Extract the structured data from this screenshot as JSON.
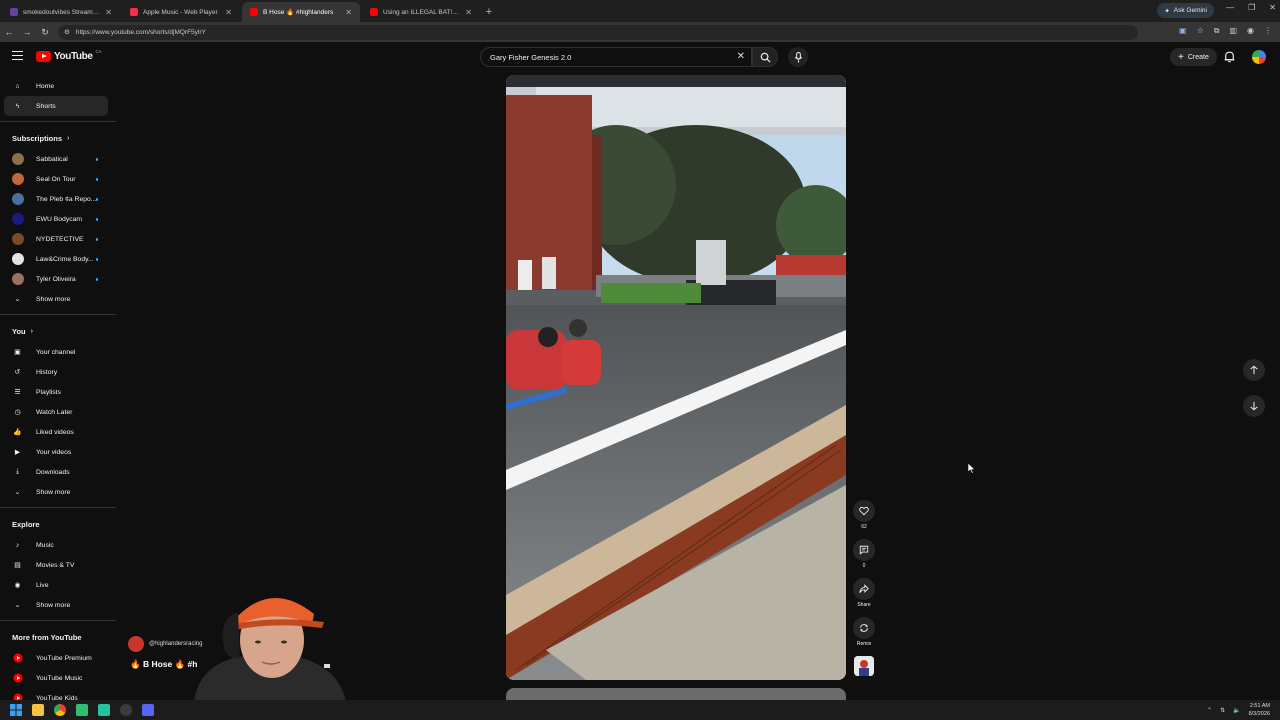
{
  "browser": {
    "tabs": [
      {
        "title": "smokedoutvibes Stream - Watc",
        "favicon_color": "#6441a5",
        "active": false
      },
      {
        "title": "Apple Music - Web Player",
        "favicon_color": "#fa2d48",
        "active": false
      },
      {
        "title": "B Hose 🔥 #highlanders",
        "favicon_color": "#ff0000",
        "active": true
      },
      {
        "title": "Using an ILLEGAL BAT! 😮 🤯",
        "favicon_color": "#ff0000",
        "active": false
      }
    ],
    "ask_gemini": "Ask Gemini",
    "url": "https://www.youtube.com/shorts/djMQrF5ylrY"
  },
  "header": {
    "logo_text": "YouTube",
    "logo_country": "CA",
    "search_value": "Gary Fisher Genesis 2.0",
    "create_label": "Create"
  },
  "sidebar": {
    "main": [
      {
        "label": "Home",
        "icon": "home-icon",
        "active": false
      },
      {
        "label": "Shorts",
        "icon": "shorts-icon",
        "active": true
      }
    ],
    "subscriptions_title": "Subscriptions",
    "subscriptions": [
      {
        "label": "Sabbatical",
        "color": "#8b6f4e"
      },
      {
        "label": "Seal On Tour",
        "color": "#c06a3c"
      },
      {
        "label": "The Pleb ¢a Repo...",
        "color": "#4a6fa5"
      },
      {
        "label": "EWU Bodycam",
        "color": "#1a1a80"
      },
      {
        "label": "NYDETECTIVE",
        "color": "#7a4a2a"
      },
      {
        "label": "Law&Crime Body...",
        "color": "#e5e5e5"
      },
      {
        "label": "Tyler Oliveira",
        "color": "#9a7060"
      }
    ],
    "subs_show_more": "Show more",
    "you_title": "You",
    "you": [
      {
        "label": "Your channel",
        "icon": "channel-icon"
      },
      {
        "label": "History",
        "icon": "history-icon"
      },
      {
        "label": "Playlists",
        "icon": "playlists-icon"
      },
      {
        "label": "Watch Later",
        "icon": "watch-later-icon"
      },
      {
        "label": "Liked videos",
        "icon": "thumbs-up-icon"
      },
      {
        "label": "Your videos",
        "icon": "your-videos-icon"
      },
      {
        "label": "Downloads",
        "icon": "download-icon"
      }
    ],
    "you_show_more": "Show more",
    "explore_title": "Explore",
    "explore": [
      {
        "label": "Music",
        "icon": "music-icon"
      },
      {
        "label": "Movies & TV",
        "icon": "movies-icon"
      },
      {
        "label": "Live",
        "icon": "live-icon"
      }
    ],
    "explore_show_more": "Show more",
    "more_title": "More from YouTube",
    "more": [
      {
        "label": "YouTube Premium"
      },
      {
        "label": "YouTube Music"
      },
      {
        "label": "YouTube Kids"
      }
    ]
  },
  "short": {
    "channel_handle": "@highlandersracing",
    "title": "🔥 B Hose 🔥 #h",
    "likes": "62",
    "comments": "0",
    "share_label": "Share",
    "remix_label": "Remix"
  },
  "taskbar": {
    "time": "2:51 AM",
    "date": "8/3/2026"
  },
  "colors": {
    "background": "#0f0f0f",
    "youtube_red": "#ff0000",
    "active_item": "#272727"
  }
}
